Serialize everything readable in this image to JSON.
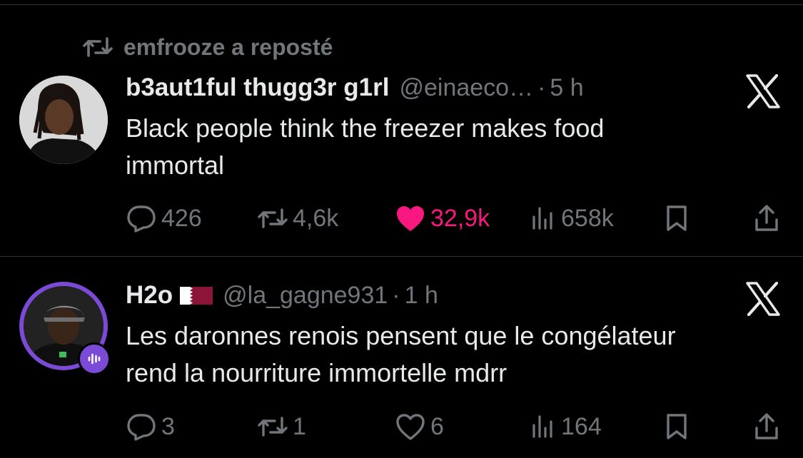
{
  "repost": {
    "text": "emfrooze a reposté",
    "icon": "repost-icon"
  },
  "tweets": [
    {
      "author_name": "b3aut1ful thugg3r g1rl",
      "handle": "@einaeco…",
      "time": "5 h",
      "lines": [
        "Black people think the freezer makes food",
        "immortal"
      ],
      "replies": "426",
      "reposts": "4,6k",
      "likes": "32,9k",
      "liked": true,
      "views": "658k"
    },
    {
      "author_name": "H2o",
      "handle": "@la_gagne931",
      "time": "1 h",
      "flag_icon": "qatar-flag-icon",
      "lines": [
        "Les daronnes renois pensent que le congélateur",
        "rend la nourriture immortelle mdrr"
      ],
      "replies": "3",
      "reposts": "1",
      "likes": "6",
      "liked": false,
      "views": "164"
    }
  ],
  "colors": {
    "background": "#000000",
    "text": "#e7e9ea",
    "muted": "#71767b",
    "like_active": "#f91880",
    "spaces_ring": "#7b4bd8",
    "divider": "#2f3336"
  }
}
